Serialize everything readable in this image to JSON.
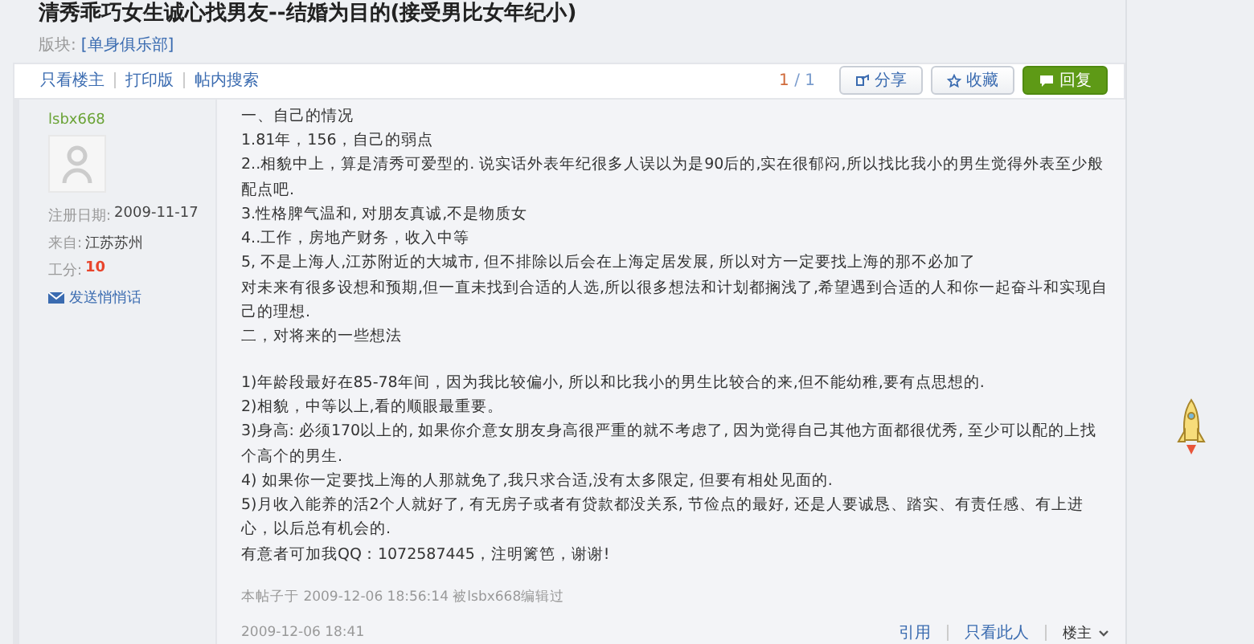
{
  "title": "清秀乖巧女生诚心找男友--结婚为目的(接受男比女年纪小)",
  "board": {
    "label": "版块:",
    "value": "[单身俱乐部]"
  },
  "toolbar_links": [
    "只看楼主",
    "打印版",
    "帖内搜索"
  ],
  "pager": {
    "current": "1",
    "separator": "/",
    "total": "1"
  },
  "actions": [
    {
      "label": "分享",
      "kind": "share"
    },
    {
      "label": "收藏",
      "kind": "star"
    },
    {
      "label": "回复",
      "kind": "reply"
    }
  ],
  "author": {
    "name": "lsbx668",
    "fields": [
      {
        "label": "注册日期:",
        "value": "2009-11-17",
        "kind": "plain"
      },
      {
        "label": "来自:",
        "value": "江苏苏州",
        "kind": "plain"
      },
      {
        "label": "工分:",
        "value": "10",
        "kind": "points"
      }
    ],
    "message_link": "发送悄悄话"
  },
  "sections": [
    [
      "一、自己的情况",
      "1.81年，156，自己的弱点",
      "2..相貌中上，算是清秀可爱型的. 说实话外表年纪很多人误以为是90后的,实在很郁闷,所以找比我小的男生觉得外表至少般配点吧.",
      "3.性格脾气温和, 对朋友真诚,不是物质女",
      "4..工作，房地产财务，收入中等",
      "5, 不是上海人,江苏附近的大城市, 但不排除以后会在上海定居发展, 所以对方一定要找上海的那不必加了",
      "对未来有很多设想和预期,但一直未找到合适的人选,所以很多想法和计划都搁浅了,希望遇到合适的人和你一起奋斗和实现自己的理想.",
      "二，对将来的一些想法"
    ],
    [
      "1)年龄段最好在85-78年间，因为我比较偏小, 所以和比我小的男生比较合的来,但不能幼稚,要有点思想的.",
      "2)相貌，中等以上,看的顺眼最重要。",
      "3)身高: 必须170以上的, 如果你介意女朋友身高很严重的就不考虑了, 因为觉得自己其他方面都很优秀, 至少可以配的上找个高个的男生.",
      "4) 如果你一定要找上海的人那就免了,我只求合适,没有太多限定, 但要有相处见面的.",
      "5)月收入能养的活2个人就好了, 有无房子或者有贷款都没关系, 节俭点的最好, 还是人要诚恳、踏实、有责任感、有上进心，以后总有机会的.",
      "有意者可加我QQ：1072587445，注明篱笆，谢谢!"
    ]
  ],
  "edit_note": "本帖子于 2009-12-06 18:56:14 被lsbx668编辑过",
  "post_time": "2009-12-06 18:41",
  "footer_links": [
    "引用",
    "只看此人"
  ],
  "floor": "楼主"
}
